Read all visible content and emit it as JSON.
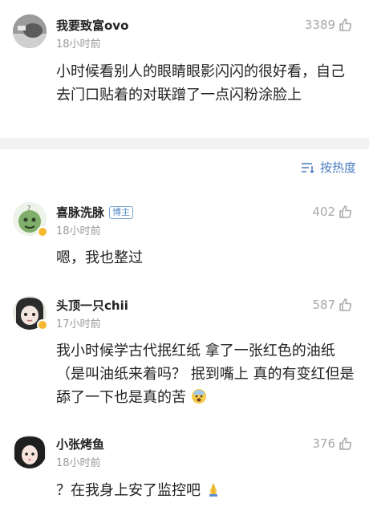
{
  "comments_top": {
    "username": "我要致富ovo",
    "time": "18小时前",
    "likes": "3389",
    "text": "小时候看别人的眼睛眼影闪闪的很好看，自己去门口贴着的对联蹭了一点闪粉涂脸上"
  },
  "sort": {
    "label": "按热度"
  },
  "replies": [
    {
      "username": "喜脉洗脉",
      "badge": "博主",
      "time": "18小时前",
      "likes": "402",
      "text": "嗯，我也整过"
    },
    {
      "username": "头顶一只chii",
      "time": "17小时前",
      "likes": "587",
      "text": "我小时候学古代抿红纸 拿了一张红色的油纸（是叫油纸来着吗？ 抿到嘴上 真的有变红但是舔了一下也是真的苦"
    },
    {
      "username": "小张烤鱼",
      "time": "18小时前",
      "likes": "376",
      "text": "？在我身上安了监控吧"
    }
  ],
  "colors": {
    "link": "#4a7bc0",
    "muted": "#9a9a9a",
    "divider": "#f2f2f2",
    "verified": "#f5b82e"
  }
}
